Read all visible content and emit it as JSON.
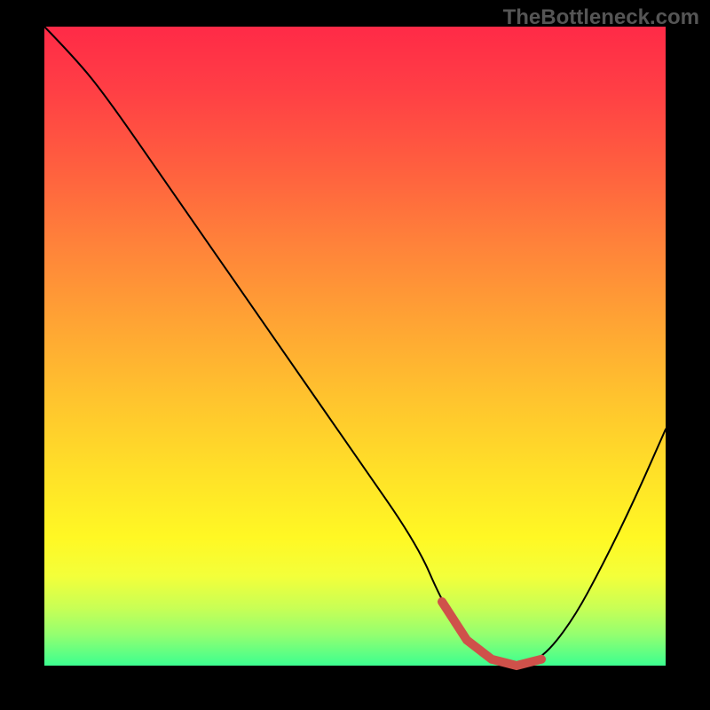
{
  "watermark": "TheBottleneck.com",
  "colors": {
    "curve": "#000000",
    "highlight": "#cf514a"
  },
  "chart_data": {
    "type": "line",
    "title": "",
    "xlabel": "",
    "ylabel": "",
    "xlim": [
      0,
      100
    ],
    "ylim": [
      0,
      100
    ],
    "x": [
      0,
      5,
      10,
      20,
      30,
      40,
      50,
      60,
      64,
      68,
      72,
      76,
      80,
      85,
      90,
      95,
      100
    ],
    "values": [
      100,
      95,
      89,
      75,
      61,
      47,
      33,
      19,
      10,
      4,
      1,
      0,
      1,
      7,
      16,
      26,
      37
    ],
    "highlight_range_x": [
      64,
      80
    ]
  }
}
